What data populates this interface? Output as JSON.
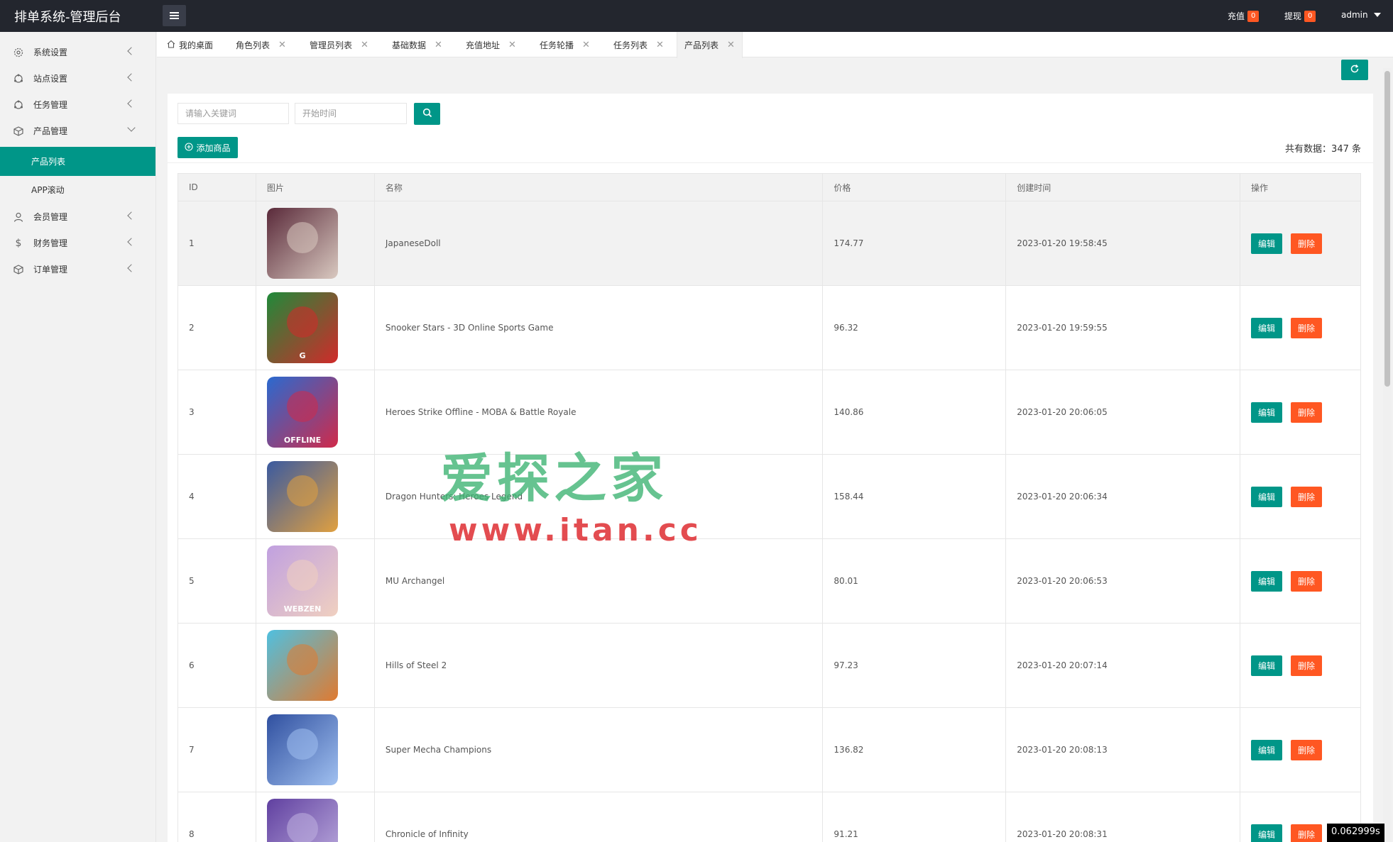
{
  "header": {
    "title": "排单系统-管理后台",
    "recharge_label": "充值",
    "recharge_count": "0",
    "withdraw_label": "提现",
    "withdraw_count": "0",
    "user": "admin"
  },
  "sidebar": {
    "items": [
      {
        "label": "系统设置",
        "icon": "gear-icon"
      },
      {
        "label": "站点设置",
        "icon": "network-icon"
      },
      {
        "label": "任务管理",
        "icon": "network-icon"
      },
      {
        "label": "产品管理",
        "icon": "box-icon"
      },
      {
        "label": "会员管理",
        "icon": "user-icon"
      },
      {
        "label": "财务管理",
        "icon": "dollar-icon"
      },
      {
        "label": "订单管理",
        "icon": "box-icon"
      }
    ],
    "subitems": [
      "产品列表",
      "APP滚动"
    ]
  },
  "tabs": [
    "我的桌面",
    "角色列表",
    "管理员列表",
    "基础数据",
    "充值地址",
    "任务轮播",
    "任务列表",
    "产品列表"
  ],
  "toolbar": {
    "keyword_placeholder": "请输入关键词",
    "date_placeholder": "开始时间",
    "add_label": "添加商品",
    "total_text": "共有数据：347 条"
  },
  "table": {
    "headers": [
      "ID",
      "图片",
      "名称",
      "价格",
      "创建时间",
      "操作"
    ],
    "edit_label": "编辑",
    "delete_label": "删除",
    "rows": [
      {
        "id": "1",
        "name": "JapaneseDoll",
        "price": "174.77",
        "created": "2023-01-20 19:58:45"
      },
      {
        "id": "2",
        "name": "Snooker Stars - 3D Online Sports Game",
        "price": "96.32",
        "created": "2023-01-20 19:59:55"
      },
      {
        "id": "3",
        "name": "Heroes Strike Offline - MOBA & Battle Royale",
        "price": "140.86",
        "created": "2023-01-20 20:06:05"
      },
      {
        "id": "4",
        "name": "Dragon Hunters: Heroes Legend",
        "price": "158.44",
        "created": "2023-01-20 20:06:34"
      },
      {
        "id": "5",
        "name": "MU Archangel",
        "price": "80.01",
        "created": "2023-01-20 20:06:53"
      },
      {
        "id": "6",
        "name": "Hills of Steel 2",
        "price": "97.23",
        "created": "2023-01-20 20:07:14"
      },
      {
        "id": "7",
        "name": "Super Mecha Champions",
        "price": "136.82",
        "created": "2023-01-20 20:08:13"
      },
      {
        "id": "8",
        "name": "Chronicle of Infinity",
        "price": "91.21",
        "created": "2023-01-20 20:08:31"
      }
    ]
  },
  "thumb_colors": [
    [
      "#5a2a3a",
      "#d9c9c0"
    ],
    [
      "#1f8a3a",
      "#d12a2a"
    ],
    [
      "#2a6ad0",
      "#d02a4a"
    ],
    [
      "#3a5aa0",
      "#e0a040"
    ],
    [
      "#c0a0e0",
      "#f0d0c0"
    ],
    [
      "#4fc0e0",
      "#e07a30"
    ],
    [
      "#3050a0",
      "#a0c0f0"
    ],
    [
      "#6040a0",
      "#c0b0e0"
    ]
  ],
  "thumb_texts": [
    "",
    "G",
    "OFFLINE",
    "",
    "WEBZEN",
    "",
    "",
    ""
  ],
  "watermark": {
    "title": "爱探之家",
    "url": "www.itan.cc"
  },
  "timer": "0.062999s",
  "accent_color": "#009688",
  "danger_color": "#ff5722"
}
